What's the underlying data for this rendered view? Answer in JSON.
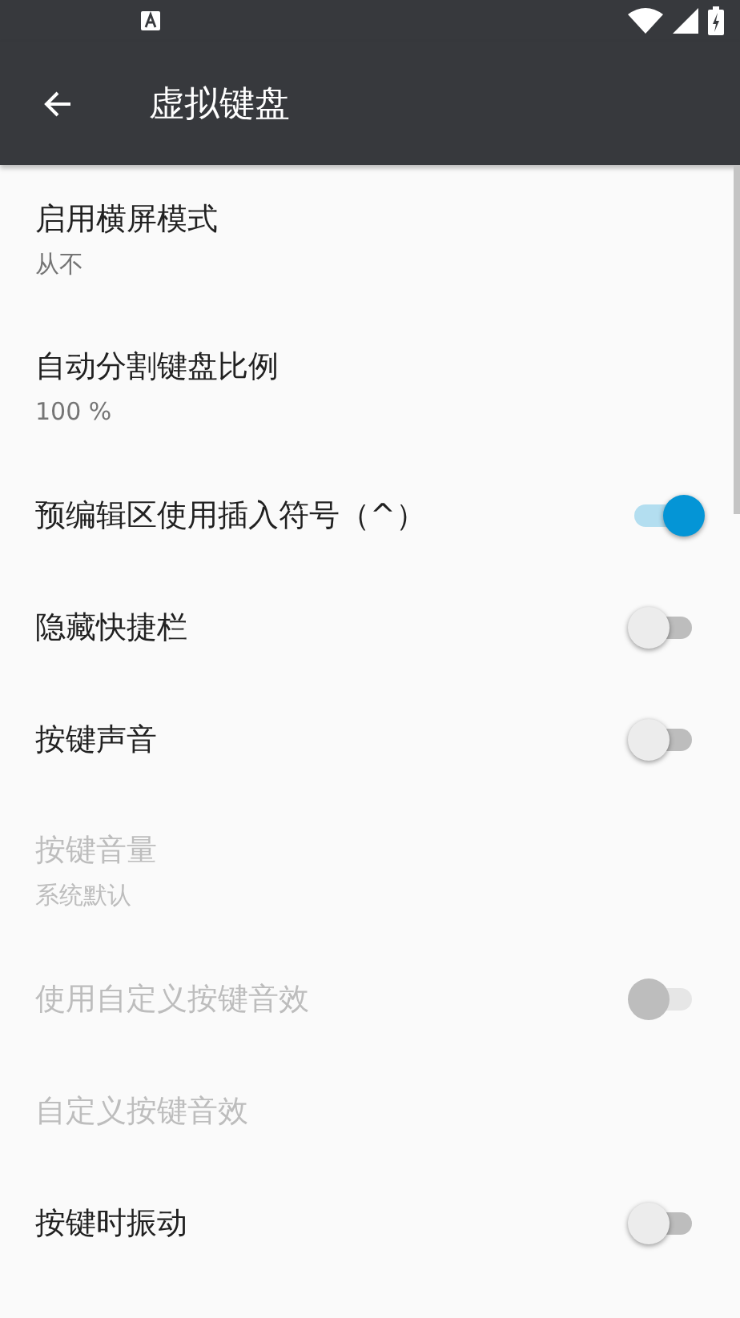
{
  "app_bar": {
    "title": "虚拟键盘"
  },
  "settings": [
    {
      "kind": "text",
      "title": "启用横屏模式",
      "summary": "从不",
      "disabled": false
    },
    {
      "kind": "text",
      "title": "自动分割键盘比例",
      "summary": "100 %",
      "disabled": false
    },
    {
      "kind": "switch",
      "title": "预编辑区使用插入符号（^）",
      "on": true,
      "disabled": false
    },
    {
      "kind": "switch",
      "title": "隐藏快捷栏",
      "on": false,
      "disabled": false
    },
    {
      "kind": "switch",
      "title": "按键声音",
      "on": false,
      "disabled": false
    },
    {
      "kind": "text",
      "title": "按键音量",
      "summary": "系统默认",
      "disabled": true
    },
    {
      "kind": "switch",
      "title": "使用自定义按键音效",
      "on": false,
      "disabled": true
    },
    {
      "kind": "text",
      "title": "自定义按键音效",
      "disabled": true
    },
    {
      "kind": "switch",
      "title": "按键时振动",
      "on": false,
      "disabled": false
    }
  ]
}
